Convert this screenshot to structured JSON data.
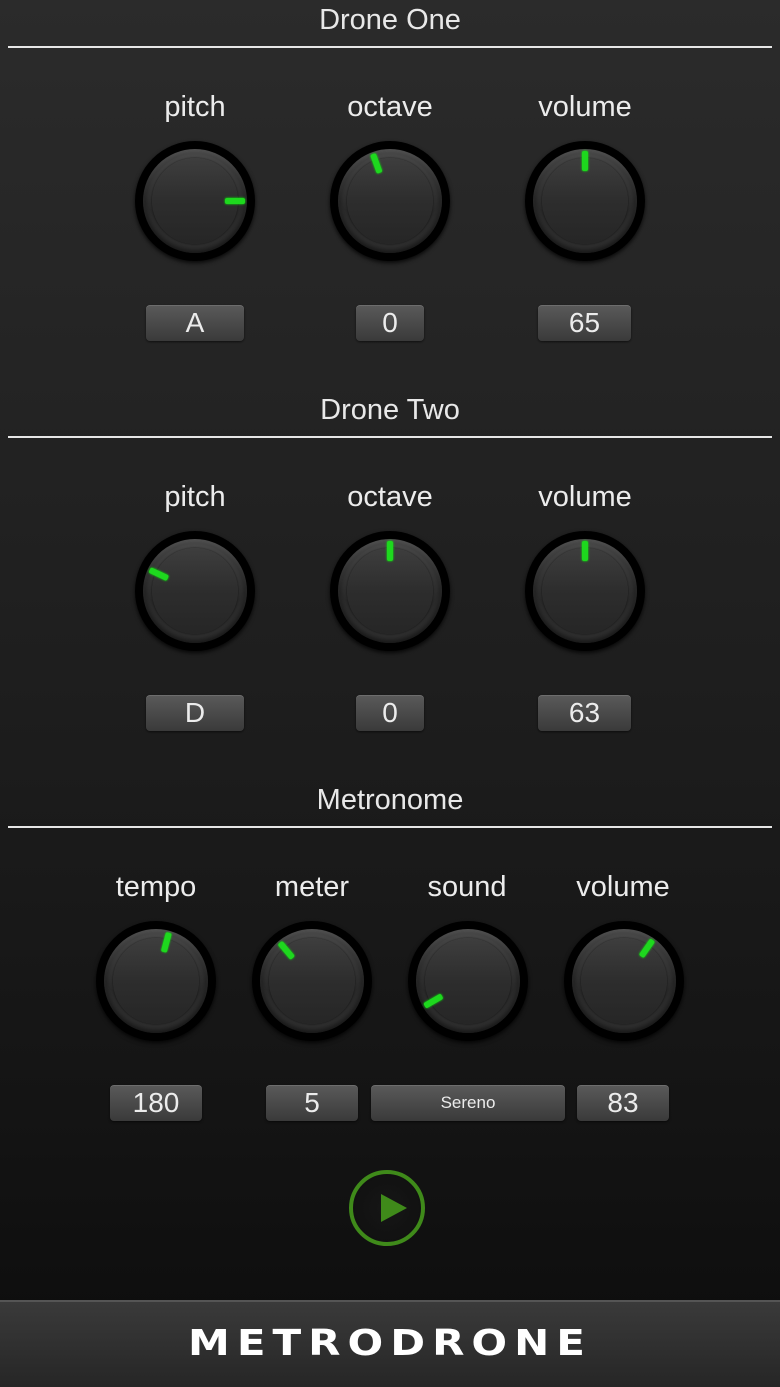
{
  "drone_one": {
    "title": "Drone One",
    "knobs": [
      {
        "label": "pitch",
        "value": "A",
        "angle": 90
      },
      {
        "label": "octave",
        "value": "0",
        "angle": -20
      },
      {
        "label": "volume",
        "value": "65",
        "angle": 0
      }
    ]
  },
  "drone_two": {
    "title": "Drone Two",
    "knobs": [
      {
        "label": "pitch",
        "value": "D",
        "angle": -65
      },
      {
        "label": "octave",
        "value": "0",
        "angle": 0
      },
      {
        "label": "volume",
        "value": "63",
        "angle": 0
      }
    ]
  },
  "metronome": {
    "title": "Metronome",
    "knobs": [
      {
        "label": "tempo",
        "value": "180",
        "angle": 15
      },
      {
        "label": "meter",
        "value": "5",
        "angle": -40
      },
      {
        "label": "sound",
        "value": "Sereno",
        "angle": -120
      },
      {
        "label": "volume",
        "value": "83",
        "angle": 35
      }
    ]
  },
  "play_button": {
    "icon": "play-icon",
    "color": "#3f8a1a"
  },
  "footer": {
    "brand": "METRODRONE"
  },
  "colors": {
    "indicator": "#1ed81e",
    "accent": "#3f8a1a"
  }
}
